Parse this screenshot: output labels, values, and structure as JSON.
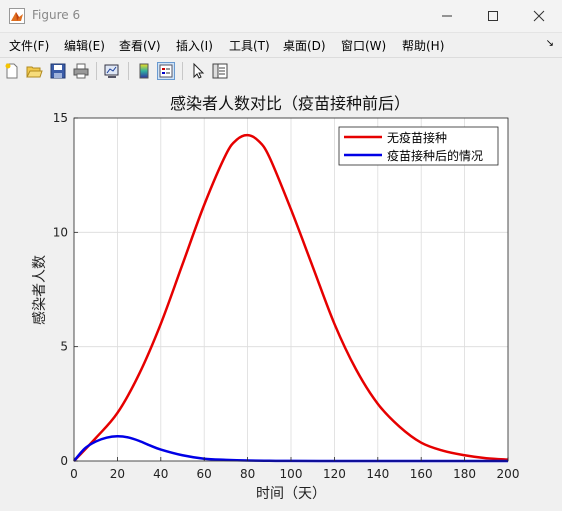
{
  "window": {
    "title": "Figure 6",
    "buttons": [
      "minimize",
      "maximize",
      "close"
    ]
  },
  "menu": {
    "items": [
      "文件(F)",
      "编辑(E)",
      "查看(V)",
      "插入(I)",
      "工具(T)",
      "桌面(D)",
      "窗口(W)",
      "帮助(H)"
    ]
  },
  "toolbar": {
    "icons": [
      "new-figure-icon",
      "open-file-icon",
      "save-icon",
      "print-icon",
      "link-plot-icon",
      "insert-colorbar-icon",
      "insert-legend-icon",
      "pointer-icon",
      "property-inspector-icon"
    ]
  },
  "colors": {
    "series1": "#e60000",
    "series2": "#0000e6",
    "grid": "#dcdcdc"
  },
  "chart_data": {
    "type": "line",
    "title": "感染者人数对比（疫苗接种前后）",
    "xlabel": "时间（天）",
    "ylabel": "感染者人数",
    "xlim": [
      0,
      200
    ],
    "ylim": [
      0,
      15
    ],
    "xticks": [
      0,
      20,
      40,
      60,
      80,
      100,
      120,
      140,
      160,
      180,
      200
    ],
    "yticks": [
      0,
      5,
      10,
      15
    ],
    "grid": true,
    "legend_position": "top-right",
    "series": [
      {
        "name": "无疫苗接种",
        "color": "#e60000",
        "x": [
          0,
          10,
          20,
          30,
          40,
          50,
          60,
          70,
          75,
          80,
          85,
          90,
          100,
          110,
          120,
          130,
          140,
          150,
          160,
          170,
          180,
          190,
          200
        ],
        "y": [
          0,
          1.0,
          2.1,
          3.8,
          6.0,
          8.6,
          11.2,
          13.4,
          14.05,
          14.25,
          14.0,
          13.3,
          11.0,
          8.5,
          6.0,
          4.0,
          2.5,
          1.5,
          0.8,
          0.45,
          0.25,
          0.12,
          0.06
        ]
      },
      {
        "name": "疫苗接种后的情况",
        "color": "#0000e6",
        "x": [
          0,
          5,
          10,
          15,
          20,
          25,
          30,
          35,
          40,
          50,
          60,
          70,
          80,
          90,
          100,
          120,
          140,
          160,
          180,
          200
        ],
        "y": [
          0,
          0.55,
          0.85,
          1.02,
          1.08,
          1.03,
          0.88,
          0.68,
          0.5,
          0.25,
          0.1,
          0.05,
          0.02,
          0.01,
          0.005,
          0,
          0,
          0,
          0,
          0
        ]
      }
    ]
  }
}
